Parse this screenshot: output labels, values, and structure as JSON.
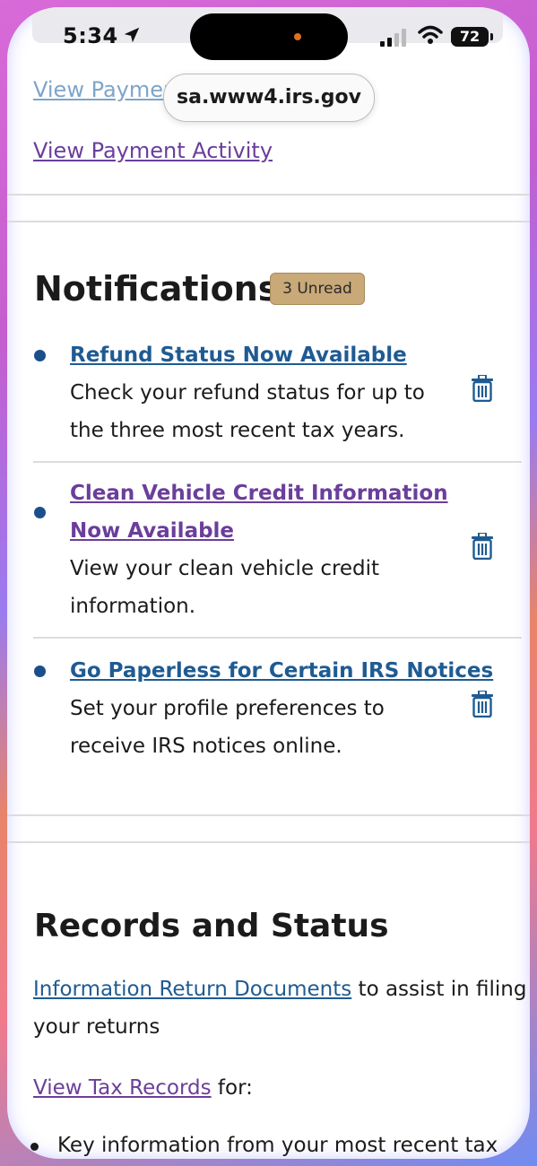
{
  "status_bar": {
    "time": "5:34",
    "battery": "72"
  },
  "browser": {
    "url": "sa.www4.irs.gov"
  },
  "payments": {
    "faded_link": "View Paymen",
    "activity_link": "View Payment Activity"
  },
  "notifications": {
    "title": "Notifications",
    "unread_badge": "3 Unread",
    "items": [
      {
        "title_lines": [
          "Refund Status Now Available"
        ],
        "desc_lines": [
          "Check your refund status for up to",
          "the three most recent tax years."
        ]
      },
      {
        "title_lines": [
          "Clean Vehicle Credit Information",
          "Now Available"
        ],
        "desc_lines": [
          "View your clean vehicle credit",
          "information."
        ]
      },
      {
        "title_lines": [
          "Go Paperless for Certain IRS Notices"
        ],
        "desc_lines": [
          "Set your profile preferences to",
          "receive IRS notices online."
        ]
      }
    ]
  },
  "records": {
    "title": "Records and Status",
    "info_link": "Information Return Documents",
    "info_text": " to assist in filing",
    "info_text2": "your returns",
    "tax_records_link": "View Tax Records",
    "tax_records_text": " for:",
    "key_info": "Key information from your most recent tax"
  },
  "colors": {
    "link_blue": "#1f5b92",
    "link_purple": "#6b3e9b",
    "badge_tan": "#c9a978",
    "bullet_blue": "#1a4f8b"
  }
}
